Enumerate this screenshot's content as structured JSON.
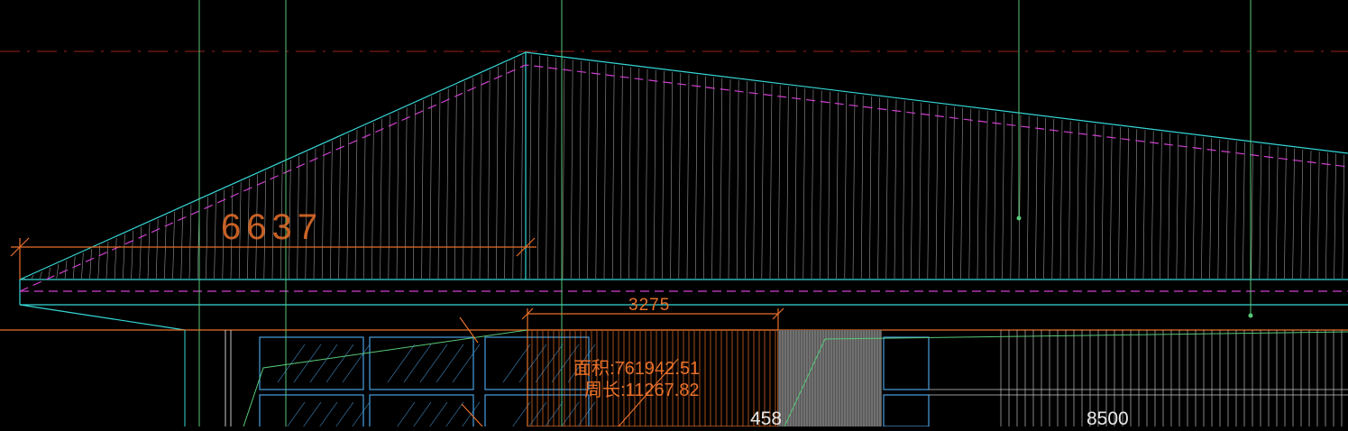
{
  "viewport": {
    "background": "#000000"
  },
  "colors": {
    "roof_edge": "#36d6d6",
    "hatch": "#c8c8c8",
    "grid_axis": "#58c878",
    "dimension": "#e8702a",
    "hidden_line": "#d040d0",
    "center_line": "#9a2020",
    "wall_fill": "#8a8a8a",
    "glazing": "#4aa0e0"
  },
  "dimensions": {
    "slope_length": "6637",
    "opening_width": "3275",
    "segment_small": "458",
    "segment_large": "8500"
  },
  "measurement": {
    "area_line": "面积:761942.51",
    "perimeter_line": "周长:11267.82"
  }
}
